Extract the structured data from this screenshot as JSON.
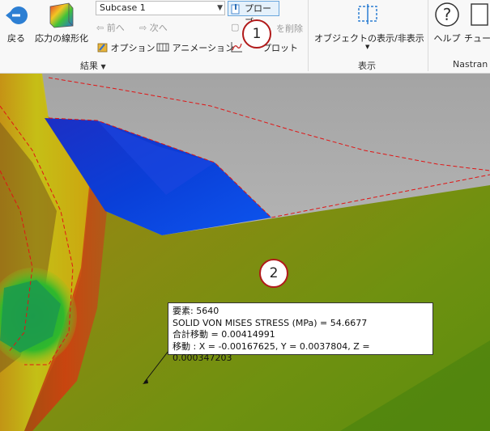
{
  "ribbon": {
    "back_label": "戻る",
    "linearize_label": "応力の線形化",
    "subcase_value": "Subcase 1",
    "probe_label": "プローブ",
    "prev_label": "前へ",
    "next_label": "次へ",
    "delete_label": "を削除",
    "options_label": "オプション",
    "animation_label": "アニメーション",
    "plot_label": "プロット",
    "results_group_label": "結果",
    "object_visibility_label": "オブジェクトの表示/非表示",
    "display_group_label": "表示",
    "help_label": "ヘルプ",
    "tutorial_label": "チュート",
    "nastran_label": "Nastran"
  },
  "callouts": [
    "1",
    "2"
  ],
  "probe": {
    "element": "要素: 5640",
    "stress": "SOLID VON MISES STRESS (MPa)  = 54.6677",
    "total_disp": "合計移動 = 0.00414991",
    "disp": "移動 : X = -0.00167625, Y = 0.0037804, Z = 0.000347203"
  }
}
